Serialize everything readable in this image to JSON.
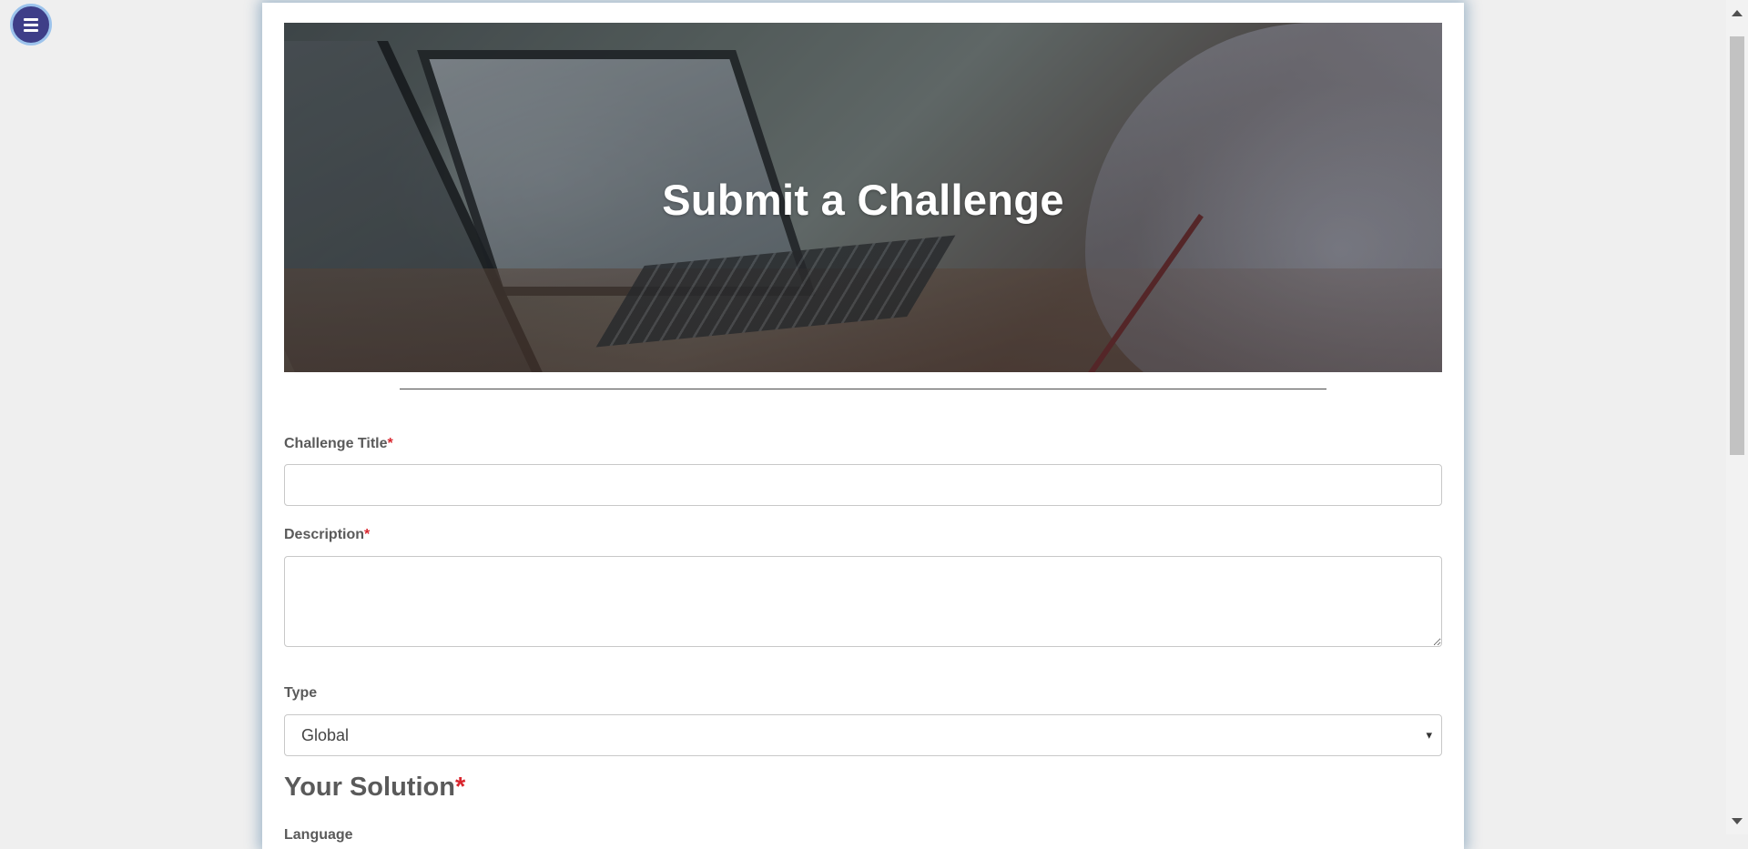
{
  "menu": {
    "icon": "hamburger-menu-icon"
  },
  "hero": {
    "title": "Submit a Challenge"
  },
  "form": {
    "challenge_title": {
      "label": "Challenge Title",
      "required_mark": "*",
      "value": "",
      "placeholder": ""
    },
    "description": {
      "label": "Description",
      "required_mark": "*",
      "value": "",
      "placeholder": ""
    },
    "type": {
      "label": "Type",
      "selected": "Global",
      "caret": "▾"
    },
    "solution": {
      "heading": "Your Solution",
      "required_mark": "*"
    },
    "language": {
      "label": "Language"
    }
  },
  "colors": {
    "accent_menu": "#3e3e88",
    "required": "#d9262e",
    "label_text": "#5a5a5a"
  }
}
